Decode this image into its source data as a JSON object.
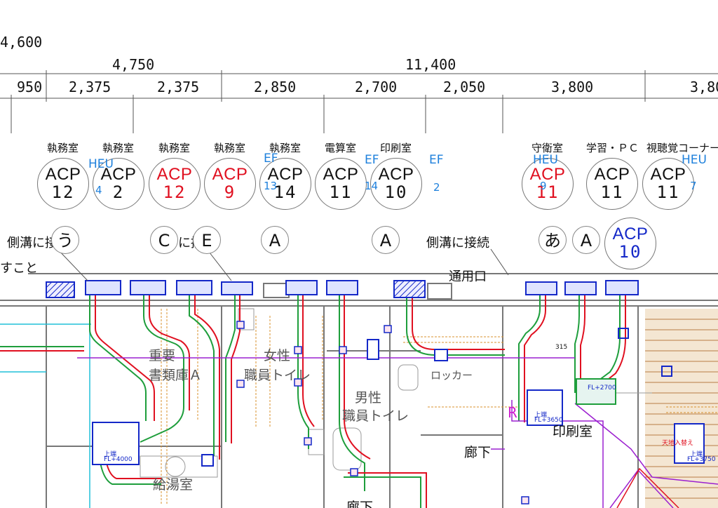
{
  "dimensions": {
    "top": "4,600",
    "upper": [
      "4,750",
      "11,400"
    ],
    "lower": [
      "950",
      "2,375",
      "2,375",
      "2,850",
      "2,700",
      "2,050",
      "3,800",
      "3,80"
    ]
  },
  "room_labels": [
    "執務室",
    "執務室",
    "執務室",
    "執務室",
    "執務室",
    "電算室",
    "印刷室",
    "守衛室",
    "学習・ＰＣ",
    "視聴覚コーナー"
  ],
  "units": [
    {
      "unit": "ACP",
      "num": "12",
      "color": "#111111"
    },
    {
      "unit": "ACP",
      "num": "2",
      "color": "#111111"
    },
    {
      "unit": "ACP",
      "num": "12",
      "color": "#e01020"
    },
    {
      "unit": "ACP",
      "num": "9",
      "color": "#e01020"
    },
    {
      "unit": "ACP",
      "num": "14",
      "color": "#111111"
    },
    {
      "unit": "ACP",
      "num": "11",
      "color": "#111111"
    },
    {
      "unit": "ACP",
      "num": "10",
      "color": "#111111"
    },
    {
      "unit": "ACP",
      "num": "11",
      "color": "#e01020"
    },
    {
      "unit": "ACP",
      "num": "11",
      "color": "#111111"
    },
    {
      "unit": "ACP",
      "num": "11",
      "color": "#111111"
    },
    {
      "unit": "ACP",
      "num": "10",
      "color": "#1428c8"
    }
  ],
  "fan_tags": [
    {
      "label": "HEU",
      "num": "4"
    },
    {
      "label": "EF",
      "num": "13"
    },
    {
      "label": "EF",
      "num": "14"
    },
    {
      "label": "EF",
      "num": "2"
    },
    {
      "label": "HEU",
      "num": "9"
    },
    {
      "label": "HEU",
      "num": "7"
    }
  ],
  "notes": {
    "drain_left": "側溝に接",
    "drain_mid": "側溝に接続",
    "drain_partial": "に接",
    "koto": "すこと",
    "passage": "通用口"
  },
  "markers": [
    "う",
    "C",
    "E",
    "A",
    "A",
    "あ",
    "A"
  ],
  "rooms": {
    "storage": [
      "重要",
      "書類庫Ａ"
    ],
    "womens": [
      "女性",
      "職員トイレ"
    ],
    "mens": [
      "男性",
      "職員トイレ"
    ],
    "locker": "ロッカー",
    "print": "印刷室",
    "corridor": "廊下",
    "corridor2": "廊下",
    "kitchen": "給湯室"
  },
  "equipment_notes": {
    "r_mark": "R",
    "fl_4000": "FL+4000",
    "fl_2700": "FL+2700",
    "fl_3650": "FL+3650",
    "fl_3750": "FL+3750",
    "fl_315": "315",
    "replace": "天地入替え",
    "up": "上端"
  },
  "colors": {
    "supply": "#1e9e3c",
    "return": "#e01020",
    "unit": "#1428c8",
    "drain": "#d8902c",
    "refrigerant": "#9c20d0",
    "wall": "#777777"
  }
}
